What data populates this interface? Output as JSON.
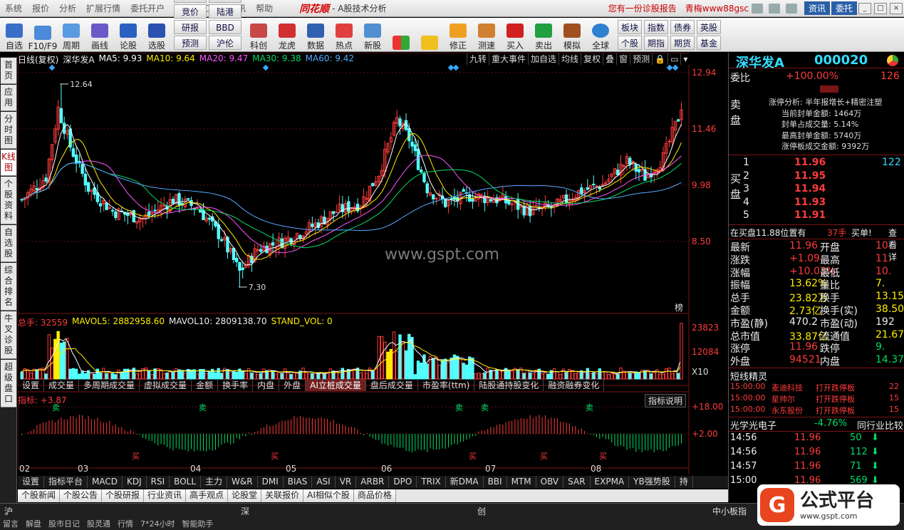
{
  "menu": {
    "items": [
      "系统",
      "报价",
      "分析",
      "扩展行情",
      "委托开户",
      "智能",
      "工具",
      "资讯",
      "帮助"
    ],
    "logo": "同花顺",
    "app_title": "- A股技术分析",
    "promo": "您有一份诊股报告",
    "user": "青梅www88gsc",
    "info_btn": "资讯",
    "trade_btn": "委托"
  },
  "toolbar": {
    "left": [
      "自选",
      "F10/F9",
      "周期",
      "画线",
      "论股",
      "选股"
    ],
    "grid1": [
      "资讯",
      "资金",
      "竞价",
      "陆港",
      "研报",
      "BBD",
      "预测",
      "沪伦"
    ],
    "mid": [
      "科创",
      "龙虎",
      "数据",
      "热点",
      "新股"
    ],
    "right": [
      "修正",
      "测速",
      "买入",
      "卖出",
      "模拟",
      "全球"
    ],
    "grid2": [
      "板块",
      "指数",
      "债券",
      "英股",
      "个股",
      "期指",
      "期货",
      "基金",
      "外汇"
    ]
  },
  "sidetabs": [
    "首页",
    "应用",
    "分时图",
    "K线图",
    "个股资料",
    "自选股",
    "综合排名",
    "牛叉诊股",
    "超级盘口"
  ],
  "main": {
    "period": "日线(复权)",
    "stock": "深华发A",
    "ma5": "MA5: 9.93",
    "ma10": "MA10: 9.64",
    "ma20": "MA20: 9.47",
    "ma30": "MA30: 9.38",
    "ma60": "MA60: 9.42",
    "tools": [
      "九转",
      "重大事件",
      "加自选",
      "均线",
      "复权",
      "叠",
      "窗",
      "预测"
    ],
    "yticks": [
      "12.94",
      "11.46",
      "9.98",
      "8.50"
    ],
    "high_label": "12.64",
    "low_label": "7.30",
    "bang": "榜",
    "watermark": "www.gspt.com"
  },
  "volume": {
    "total": "总手: 32559",
    "mavol5": "MAVOL5: 2882958.60",
    "mavol10": "MAVOL10: 2809138.70",
    "stand": "STAND_VOL: 0",
    "yticks": [
      "23823",
      "12084",
      "X10"
    ],
    "tabs": [
      "设置",
      "成交量",
      "多周期成交量",
      "虚拟成交量",
      "金额",
      "换手率",
      "内盘",
      "外盘",
      "AI立桩成交量",
      "盘后成交量",
      "市盈率(ttm)",
      "陆股通持股变化",
      "融资融券变化"
    ]
  },
  "indicator": {
    "label": "指标: +3.87",
    "explain": "指标说明",
    "yticks": [
      "+18.00",
      "+2.00"
    ],
    "sell": "卖",
    "buy": "买"
  },
  "xaxis": [
    "02",
    "03",
    "04",
    "05",
    "06",
    "07",
    "08"
  ],
  "bottomtabs": [
    "设置",
    "指标平台",
    "MACD",
    "KDJ",
    "RSI",
    "BOLL",
    "主力",
    "W&R",
    "DMI",
    "BIAS",
    "ASI",
    "VR",
    "ARBR",
    "DPO",
    "TRIX",
    "新DMA",
    "BBI",
    "MTM",
    "OBV",
    "SAR",
    "EXPMA",
    "YB强势股",
    "持"
  ],
  "newstabs": [
    "个股新闻",
    "个股公告",
    "个股研报",
    "行业资讯",
    "高手观点",
    "论股堂",
    "关联报价",
    "AI相似个股",
    "商品价格"
  ],
  "status": {
    "sh": "沪",
    "sz": "深",
    "cy": "创",
    "board": "中小板指",
    "bottom_links": [
      "留言",
      "解盘",
      "股市日记",
      "股灵通",
      "行情",
      "7*24小时",
      "智能助手"
    ]
  },
  "panel": {
    "name": "深华发A",
    "code": "000020",
    "weibi_label": "委比",
    "weibi": "+100.00%",
    "weicha": "126",
    "limit_analysis": "涨停分析: 半年报增长+精密注塑",
    "seal_amount": "当前封单金额: 1464万",
    "seal_ratio": "封单占成交量: 5.14%",
    "max_seal": "最高封单金额: 5740万",
    "limit_turnover": "涨停板成交金额: 9392万",
    "sell_label": "卖盘",
    "buy_label": "买盘",
    "bids": [
      {
        "n": "1",
        "p": "11.96",
        "v": "122"
      },
      {
        "n": "2",
        "p": "11.95",
        "v": ""
      },
      {
        "n": "3",
        "p": "11.94",
        "v": ""
      },
      {
        "n": "4",
        "p": "11.93",
        "v": ""
      },
      {
        "n": "5",
        "p": "11.91",
        "v": ""
      }
    ],
    "at_buy": "在买盘11.88位置有",
    "at_buy_vol": "37手",
    "buy1": "买单!",
    "view": "查看详",
    "stats": [
      [
        "最新",
        "11.96",
        "开盘",
        "10."
      ],
      [
        "涨跌",
        "+1.09",
        "最高",
        "11."
      ],
      [
        "涨幅",
        "+10.03%",
        "最低",
        "10."
      ],
      [
        "振幅",
        "13.62%",
        "量比",
        "7."
      ],
      [
        "总手",
        "23.82万",
        "换手",
        "13.15"
      ],
      [
        "金额",
        "2.73亿",
        "换手(实)",
        "38.50"
      ],
      [
        "市盈(静)",
        "470.2",
        "市盈(动)",
        "192"
      ],
      [
        "总市值",
        "33.87亿",
        "流通值",
        "21.67"
      ],
      [
        "涨停",
        "11.96",
        "跌停",
        "9."
      ],
      [
        "外盘",
        "94521",
        "内盘",
        "14.37"
      ]
    ],
    "elves_title": "短线精灵",
    "elves": [
      [
        "15:00:00",
        "麦迪科技",
        "打开跌停板",
        "22"
      ],
      [
        "15:00:00",
        "星帅尔",
        "打开跌停板",
        "15"
      ],
      [
        "15:00:00",
        "永东股份",
        "打开跌停板",
        "15"
      ]
    ],
    "sector": "光学光电子",
    "sector_chg": "-4.76%",
    "sector_compare": "同行业比较",
    "ticks": [
      [
        "14:56",
        "11.96",
        "50"
      ],
      [
        "14:56",
        "11.96",
        "112"
      ],
      [
        "14:57",
        "11.96",
        "71"
      ],
      [
        "15:00",
        "11.96",
        "569"
      ]
    ],
    "logo_text": "公式平台",
    "logo_url": "www.gspt.com"
  },
  "colors": {
    "up": "#ff3b3b",
    "down": "#54ffff",
    "ma5": "#ffffff",
    "ma10": "#ffee00",
    "ma20": "#ff55ff",
    "ma30": "#00dd66",
    "ma60": "#55aaff"
  },
  "chart_data": {
    "type": "candlestick",
    "title": "深华发A 000020 日线(复权)",
    "period_ticks": [
      "02",
      "03",
      "04",
      "05",
      "06",
      "07",
      "08"
    ],
    "ylim": [
      7.0,
      13.2
    ],
    "high": 12.64,
    "low": 7.3,
    "last": 11.96,
    "volume_ylim": [
      0,
      23823
    ],
    "indicator_value": 3.87
  }
}
